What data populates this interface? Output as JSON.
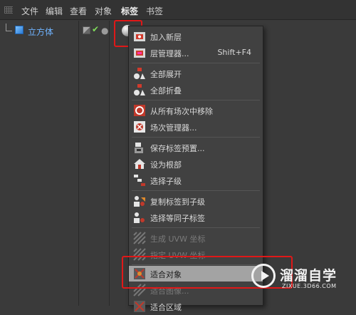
{
  "menubar": {
    "items": [
      {
        "label": "文件",
        "active": false
      },
      {
        "label": "编辑",
        "active": false
      },
      {
        "label": "查看",
        "active": false
      },
      {
        "label": "对象",
        "active": false
      },
      {
        "label": "标签",
        "active": true
      },
      {
        "label": "书签",
        "active": false
      }
    ]
  },
  "object_tree": {
    "object": {
      "name": "立方体",
      "icon": "cube-icon"
    },
    "tags": [
      "display-flag-icon",
      "check-icon",
      "dot-icon",
      "material-tag-icon"
    ]
  },
  "context_menu": {
    "groups": [
      [
        {
          "label": "加入新层",
          "shortcut": "",
          "icon": "add-layer-icon",
          "disabled": false,
          "selected": false
        },
        {
          "label": "层管理器...",
          "shortcut": "Shift+F4",
          "icon": "layer-manager-icon",
          "disabled": false,
          "selected": false
        }
      ],
      [
        {
          "label": "全部展开",
          "shortcut": "",
          "icon": "expand-all-icon",
          "disabled": false,
          "selected": false
        },
        {
          "label": "全部折叠",
          "shortcut": "",
          "icon": "collapse-all-icon",
          "disabled": false,
          "selected": false
        }
      ],
      [
        {
          "label": "从所有场次中移除",
          "shortcut": "",
          "icon": "remove-from-takes-icon",
          "disabled": false,
          "selected": false
        },
        {
          "label": "场次管理器...",
          "shortcut": "",
          "icon": "take-manager-icon",
          "disabled": false,
          "selected": false
        }
      ],
      [
        {
          "label": "保存标签预置...",
          "shortcut": "",
          "icon": "save-tag-preset-icon",
          "disabled": false,
          "selected": false
        },
        {
          "label": "设为根部",
          "shortcut": "",
          "icon": "set-as-root-icon",
          "disabled": false,
          "selected": false
        },
        {
          "label": "选择子级",
          "shortcut": "",
          "icon": "select-children-icon",
          "disabled": false,
          "selected": false
        }
      ],
      [
        {
          "label": "复制标签到子级",
          "shortcut": "",
          "icon": "copy-tag-to-children-icon",
          "disabled": false,
          "selected": false
        },
        {
          "label": "选择等同子标签",
          "shortcut": "",
          "icon": "select-identical-tags-icon",
          "disabled": false,
          "selected": false
        }
      ],
      [
        {
          "label": "生成 UVW 坐标",
          "shortcut": "",
          "icon": "generate-uvw-icon",
          "disabled": true,
          "selected": false
        },
        {
          "label": "指定 UVW 坐标",
          "shortcut": "",
          "icon": "assign-uvw-icon",
          "disabled": true,
          "selected": false
        }
      ],
      [
        {
          "label": "适合对象",
          "shortcut": "",
          "icon": "fit-to-object-icon",
          "disabled": false,
          "selected": true
        },
        {
          "label": "适合图像...",
          "shortcut": "",
          "icon": "fit-to-image-icon",
          "disabled": true,
          "selected": false
        },
        {
          "label": "适合区域",
          "shortcut": "",
          "icon": "fit-to-region-icon",
          "disabled": false,
          "selected": false
        }
      ]
    ]
  },
  "watermark": {
    "title": "溜溜自学",
    "url": "ZIXUE.3D66.COM"
  },
  "colors": {
    "highlight_box": "#e01818",
    "selected_row": "#a3a3a3",
    "object_name": "#6fb3ff"
  }
}
